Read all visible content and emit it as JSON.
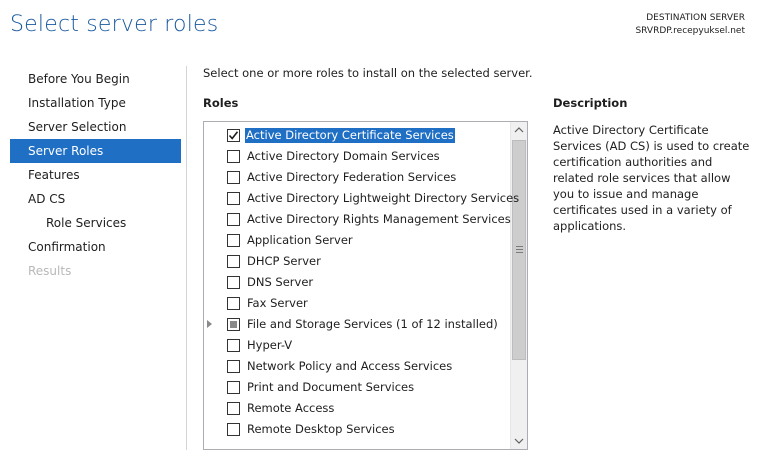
{
  "header": {
    "title": "Select server roles",
    "destination_label": "DESTINATION SERVER",
    "destination_server": "SRVRDP.recepyuksel.net"
  },
  "nav": {
    "items": [
      {
        "label": "Before You Begin",
        "state": "normal"
      },
      {
        "label": "Installation Type",
        "state": "normal"
      },
      {
        "label": "Server Selection",
        "state": "normal"
      },
      {
        "label": "Server Roles",
        "state": "active"
      },
      {
        "label": "Features",
        "state": "normal"
      },
      {
        "label": "AD CS",
        "state": "normal"
      },
      {
        "label": "Role Services",
        "state": "sub"
      },
      {
        "label": "Confirmation",
        "state": "normal"
      },
      {
        "label": "Results",
        "state": "disabled"
      }
    ]
  },
  "main": {
    "instruction": "Select one or more roles to install on the selected server.",
    "roles_heading": "Roles",
    "roles": [
      {
        "label": "Active Directory Certificate Services",
        "state": "checked",
        "selected": true
      },
      {
        "label": "Active Directory Domain Services",
        "state": "unchecked"
      },
      {
        "label": "Active Directory Federation Services",
        "state": "unchecked"
      },
      {
        "label": "Active Directory Lightweight Directory Services",
        "state": "unchecked"
      },
      {
        "label": "Active Directory Rights Management Services",
        "state": "unchecked"
      },
      {
        "label": "Application Server",
        "state": "unchecked"
      },
      {
        "label": "DHCP Server",
        "state": "unchecked"
      },
      {
        "label": "DNS Server",
        "state": "unchecked"
      },
      {
        "label": "Fax Server",
        "state": "unchecked"
      },
      {
        "label": "File and Storage Services (1 of 12 installed)",
        "state": "partial",
        "expandable": true
      },
      {
        "label": "Hyper-V",
        "state": "unchecked"
      },
      {
        "label": "Network Policy and Access Services",
        "state": "unchecked"
      },
      {
        "label": "Print and Document Services",
        "state": "unchecked"
      },
      {
        "label": "Remote Access",
        "state": "unchecked"
      },
      {
        "label": "Remote Desktop Services",
        "state": "unchecked"
      }
    ]
  },
  "description": {
    "heading": "Description",
    "text": "Active Directory Certificate Services (AD CS) is used to create certification authorities and related role services that allow you to issue and manage certificates used in a variety of applications."
  },
  "colors": {
    "title": "#1a5aa0",
    "accent": "#1f6fc5"
  }
}
